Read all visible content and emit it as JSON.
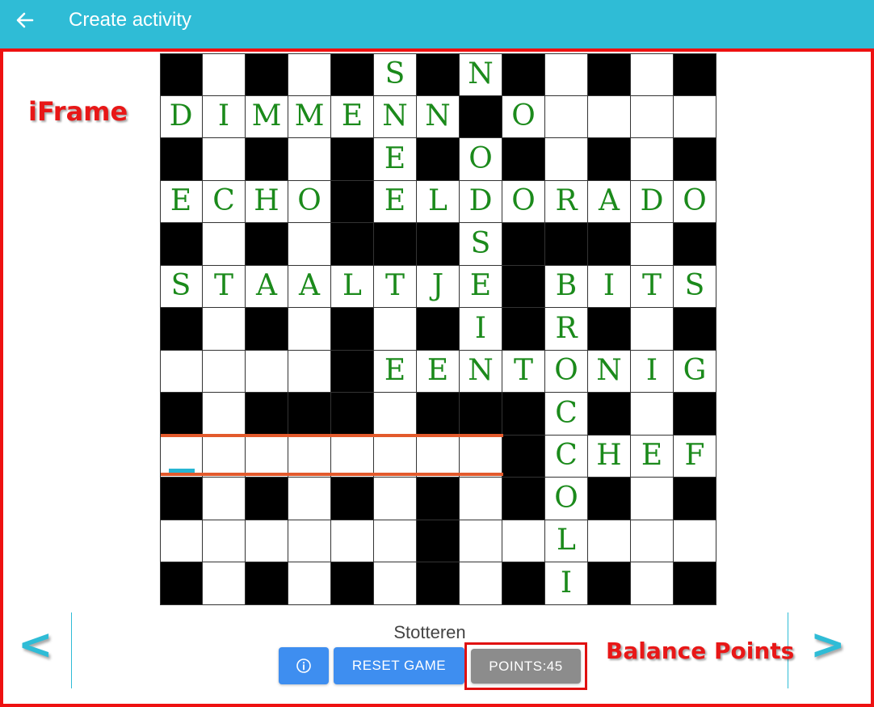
{
  "header": {
    "title": "Create activity",
    "back_icon": "arrow-left-icon"
  },
  "annotations": {
    "iframe_label": "iFrame",
    "balance_label": "Balance Points"
  },
  "crossword": {
    "columns": 13,
    "rows": 13,
    "grid": [
      "#.#.#S#N#.#.#",
      "DIMMENN#O....",
      "#.#.#E#O#.#.#",
      "ECHO#ELDORADO",
      "#.#.###S###.#",
      "STAALTJE#BITS",
      "#.#.#.#I#R#.#",
      "....#EENTONIG",
      "#.###.###C#.#",
      "........#CHEF",
      "#.#.#.#.#O#.#",
      "......#..L...",
      "#.#.#.#.#I#.#"
    ],
    "active_clue": "Stotteren"
  },
  "navigation": {
    "prev_label": "<",
    "next_label": ">"
  },
  "buttons": {
    "info_icon": "info-circle-icon",
    "reset_label": "RESET GAME",
    "points_label": "POINTS:45"
  },
  "colors": {
    "topbar": "#2fbcd6",
    "letters": "#1b8a1b",
    "primary_button": "#3e8ef0",
    "points_button": "#8c8c8c",
    "annotation": "#e81717",
    "highlight": "#e35a2c"
  }
}
